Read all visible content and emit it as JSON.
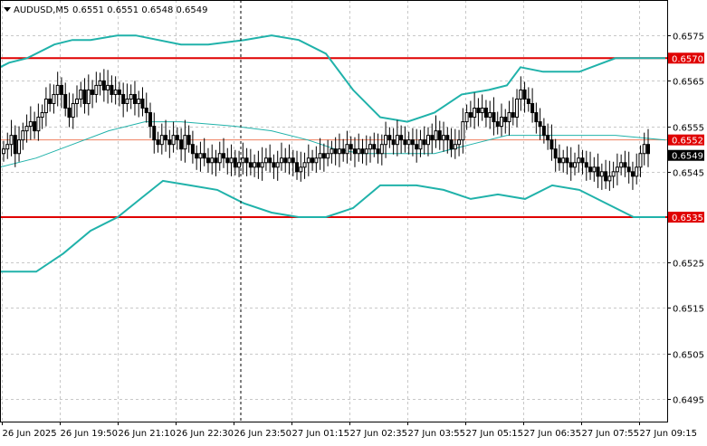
{
  "header": {
    "symbol": "AUDUSD,M5",
    "ohlc": "0.6551 0.6551 0.6548 0.6549"
  },
  "colors": {
    "candle": "#000000",
    "bollinger": "#20b2aa",
    "middle_band": "#20b2aa",
    "level_line": "#e00000",
    "current_line": "#f08060",
    "grid": "#c8c8c8",
    "cursor_line": "#000000"
  },
  "chart_data": {
    "type": "candlestick",
    "title": "AUDUSD,M5",
    "grid": true,
    "ylim": [
      0.649,
      0.65828
    ],
    "y_ticks": [
      "0.6585",
      "0.6575",
      "0.6565",
      "0.6555",
      "0.6545",
      "0.6535",
      "0.6525",
      "0.6515",
      "0.6505",
      "0.6495"
    ],
    "x_ticks": [
      "26 Jun 2025",
      "26 Jun 19:50",
      "26 Jun 21:10",
      "26 Jun 22:30",
      "26 Jun 23:50",
      "27 Jun 01:15",
      "27 Jun 02:35",
      "27 Jun 03:55",
      "27 Jun 05:15",
      "27 Jun 06:35",
      "27 Jun 07:55",
      "27 Jun 09:15"
    ],
    "levels": [
      {
        "label": "0.6570",
        "value": 0.657
      },
      {
        "label": "0.6535",
        "value": 0.6535
      }
    ],
    "current_price": {
      "label": "0.6552",
      "value": 0.6552
    },
    "last_price": {
      "label": "0.6549",
      "value": 0.6549
    },
    "closes": [
      0.655,
      0.6551,
      0.6553,
      0.6549,
      0.6552,
      0.6554,
      0.6555,
      0.6556,
      0.6554,
      0.6557,
      0.6558,
      0.6561,
      0.656,
      0.6562,
      0.6564,
      0.6562,
      0.6559,
      0.6557,
      0.656,
      0.6561,
      0.6563,
      0.656,
      0.6563,
      0.6562,
      0.6564,
      0.6565,
      0.6563,
      0.6564,
      0.6562,
      0.6563,
      0.6562,
      0.656,
      0.6561,
      0.6562,
      0.656,
      0.6561,
      0.6559,
      0.6558,
      0.6555,
      0.6552,
      0.6551,
      0.6553,
      0.6552,
      0.6551,
      0.6553,
      0.6552,
      0.655,
      0.6553,
      0.6551,
      0.6549,
      0.6548,
      0.6549,
      0.6548,
      0.6547,
      0.6548,
      0.6547,
      0.6549,
      0.6548,
      0.6547,
      0.6548,
      0.6546,
      0.6547,
      0.6548,
      0.6547,
      0.6546,
      0.6547,
      0.6546,
      0.6547,
      0.6548,
      0.6547,
      0.6546,
      0.6547,
      0.6548,
      0.6547,
      0.6548,
      0.6547,
      0.6545,
      0.6546,
      0.6547,
      0.6548,
      0.6547,
      0.6548,
      0.6549,
      0.6548,
      0.6549,
      0.655,
      0.6549,
      0.655,
      0.6549,
      0.6551,
      0.655,
      0.6549,
      0.655,
      0.6549,
      0.655,
      0.6551,
      0.655,
      0.6549,
      0.6551,
      0.6553,
      0.6552,
      0.6551,
      0.6553,
      0.6552,
      0.6551,
      0.6552,
      0.6551,
      0.655,
      0.6552,
      0.6551,
      0.6553,
      0.6552,
      0.6554,
      0.6552,
      0.6553,
      0.6552,
      0.655,
      0.6551,
      0.6552,
      0.6556,
      0.6558,
      0.6557,
      0.6559,
      0.6558,
      0.6559,
      0.6557,
      0.6558,
      0.6556,
      0.6555,
      0.6557,
      0.6556,
      0.6558,
      0.6557,
      0.6561,
      0.6563,
      0.6561,
      0.656,
      0.6558,
      0.6556,
      0.6555,
      0.6553,
      0.6552,
      0.655,
      0.6548,
      0.6547,
      0.6548,
      0.6547,
      0.6546,
      0.6547,
      0.6548,
      0.6547,
      0.6546,
      0.6545,
      0.6546,
      0.6544,
      0.6545,
      0.6543,
      0.6544,
      0.6545,
      0.6546,
      0.6547,
      0.6546,
      0.6545,
      0.6544,
      0.6546,
      0.6549,
      0.6551,
      0.6549
    ],
    "upper_band": [
      [
        0,
        0.6568
      ],
      [
        10,
        0.6569
      ],
      [
        30,
        0.657
      ],
      [
        60,
        0.6573
      ],
      [
        80,
        0.6574
      ],
      [
        100,
        0.6574
      ],
      [
        130,
        0.6575
      ],
      [
        150,
        0.6575
      ],
      [
        200,
        0.6573
      ],
      [
        230,
        0.6573
      ],
      [
        270,
        0.6574
      ],
      [
        300,
        0.6575
      ],
      [
        330,
        0.6574
      ],
      [
        360,
        0.6571
      ],
      [
        390,
        0.6563
      ],
      [
        420,
        0.6557
      ],
      [
        450,
        0.6556
      ],
      [
        480,
        0.6558
      ],
      [
        510,
        0.6562
      ],
      [
        540,
        0.6563
      ],
      [
        560,
        0.6564
      ],
      [
        575,
        0.6568
      ],
      [
        600,
        0.6567
      ],
      [
        640,
        0.6567
      ],
      [
        680,
        0.657
      ],
      [
        735,
        0.657
      ]
    ],
    "middle_band": [
      [
        0,
        0.6546
      ],
      [
        40,
        0.6548
      ],
      [
        80,
        0.6551
      ],
      [
        120,
        0.6554
      ],
      [
        160,
        0.6556
      ],
      [
        200,
        0.6556
      ],
      [
        260,
        0.6555
      ],
      [
        300,
        0.6554
      ],
      [
        340,
        0.6552
      ],
      [
        370,
        0.655
      ],
      [
        400,
        0.6549
      ],
      [
        440,
        0.6549
      ],
      [
        480,
        0.6549
      ],
      [
        520,
        0.6551
      ],
      [
        560,
        0.6553
      ],
      [
        600,
        0.6553
      ],
      [
        640,
        0.6553
      ],
      [
        680,
        0.6553
      ],
      [
        735,
        0.6552
      ]
    ],
    "lower_band": [
      [
        0,
        0.6523
      ],
      [
        40,
        0.6523
      ],
      [
        70,
        0.6527
      ],
      [
        100,
        0.6532
      ],
      [
        130,
        0.6535
      ],
      [
        155,
        0.6539
      ],
      [
        180,
        0.6543
      ],
      [
        210,
        0.6542
      ],
      [
        240,
        0.6541
      ],
      [
        270,
        0.6538
      ],
      [
        300,
        0.6536
      ],
      [
        330,
        0.6535
      ],
      [
        360,
        0.6535
      ],
      [
        390,
        0.6537
      ],
      [
        420,
        0.6542
      ],
      [
        460,
        0.6542
      ],
      [
        490,
        0.6541
      ],
      [
        520,
        0.6539
      ],
      [
        550,
        0.654
      ],
      [
        580,
        0.6539
      ],
      [
        610,
        0.6542
      ],
      [
        640,
        0.6541
      ],
      [
        670,
        0.6538
      ],
      [
        700,
        0.6535
      ],
      [
        735,
        0.6535
      ]
    ]
  }
}
